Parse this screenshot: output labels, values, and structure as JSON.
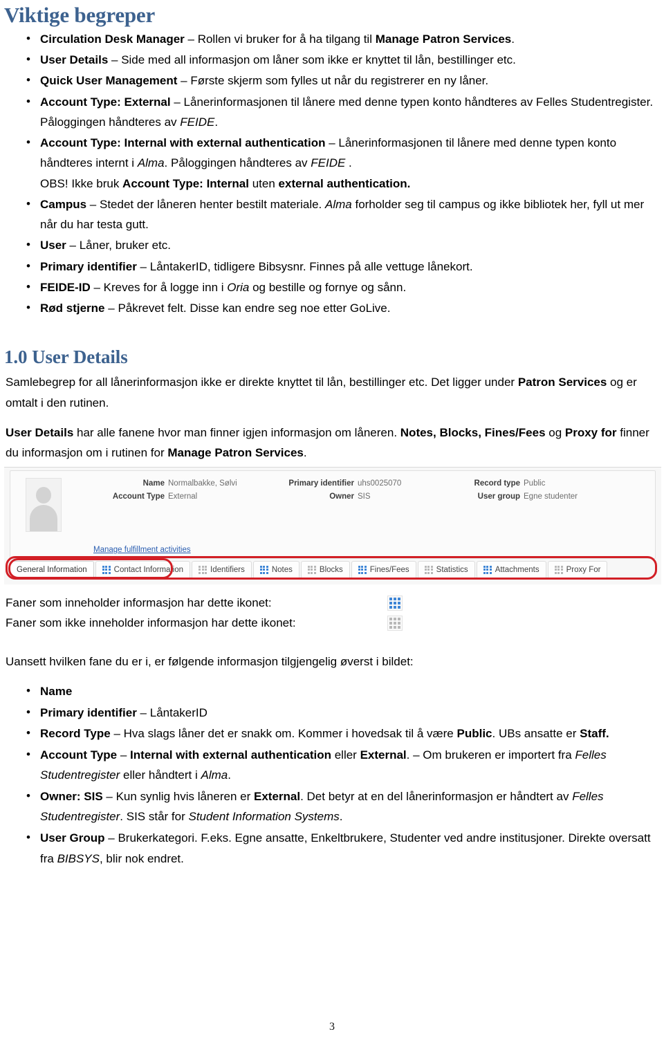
{
  "document": {
    "heading": "Viktige begreper",
    "page_number": "3"
  },
  "concepts": {
    "items": [
      {
        "term": "Circulation Desk Manager",
        "dash": " – ",
        "text_before": "Rollen vi bruker for å ha tilgang til ",
        "emphasis": "Manage Patron Services",
        "text_after": "."
      },
      {
        "term": "User Details",
        "dash": " – ",
        "text_before": "Side med all informasjon om låner som ikke er knyttet til lån, bestillinger etc.",
        "emphasis": "",
        "text_after": ""
      },
      {
        "term": "Quick User Management",
        "dash": " – ",
        "text_before": "Første skjerm som fylles ut når du registrerer en ny låner.",
        "emphasis": "",
        "text_after": ""
      }
    ],
    "account_type_external": {
      "term": "Account Type: External",
      "dash": " – ",
      "text": "Lånerinformasjonen til lånere med denne typen konto håndteres av Felles Studentregister. Påloggingen håndteres av ",
      "italic": "FEIDE",
      "text_end": "."
    },
    "account_type_internal": {
      "term": "Account Type: Internal with external authentication",
      "dash": " – ",
      "text1": "Lånerinformasjonen til lånere med denne typen konto håndteres internt i ",
      "italic1": "Alma",
      "text2": ". Påloggingen håndteres av ",
      "italic2": "FEIDE",
      "text3": " .",
      "obs_prefix": "OBS! Ikke bruk ",
      "obs_bold1": "Account Type: Internal",
      "obs_mid": " uten ",
      "obs_bold2": "external authentication."
    },
    "campus": {
      "term": "Campus",
      "dash": " – ",
      "text1": "Stedet der låneren henter bestilt materiale. ",
      "italic1": "Alma",
      "text2": " forholder seg til campus og ikke bibliotek her, fyll ut mer når du har testa gutt."
    },
    "user": {
      "term": "User",
      "dash": " – ",
      "text": "Låner, bruker etc."
    },
    "primary_identifier": {
      "term": "Primary identifier",
      "dash": " – ",
      "text": "LåntakerID, tidligere Bibsysnr. Finnes på alle vettuge lånekort."
    },
    "feide_id": {
      "term": "FEIDE-ID",
      "dash": " – ",
      "text1": "Kreves for å logge inn i ",
      "italic1": "Oria",
      "text2": " og bestille og fornye og sånn."
    },
    "rod_stjerne": {
      "term": "Rød stjerne",
      "dash": " – ",
      "text": "Påkrevet felt. Disse kan endre seg noe etter GoLive."
    }
  },
  "user_details_section": {
    "heading": "1.0 User Details",
    "paragraph1_text1": "Samlebegrep for all lånerinformasjon ikke er direkte knyttet til lån, bestillinger etc. Det ligger under ",
    "paragraph1_bold": "Patron Services",
    "paragraph1_text2": " og er omtalt i den rutinen.",
    "paragraph2_bold1": "User Details",
    "paragraph2_text1": " har alle fanene hvor man finner igjen informasjon om låneren. ",
    "paragraph2_bold2": "Notes, Blocks, Fines/Fees",
    "paragraph2_text2": " og ",
    "paragraph2_bold3": "Proxy for",
    "paragraph2_text3": " finner du informasjon om i rutinen for ",
    "paragraph2_bold4": "Manage Patron Services",
    "paragraph2_text4": "."
  },
  "alma_screenshot": {
    "fields": {
      "name_label": "Name",
      "name_value": "Normalbakke, Sølvi",
      "account_type_label": "Account Type",
      "account_type_value": "External",
      "primary_identifier_label": "Primary identifier",
      "primary_identifier_value": "uhs0025070",
      "owner_label": "Owner",
      "owner_value": "SIS",
      "record_type_label": "Record type",
      "record_type_value": "Public",
      "user_group_label": "User group",
      "user_group_value": "Egne studenter"
    },
    "manage_link": "Manage fulfillment activities",
    "tabs": [
      {
        "label": "General Information",
        "has_info": false,
        "active": true,
        "show_icon": false
      },
      {
        "label": "Contact Information",
        "has_info": true,
        "active": false,
        "show_icon": true
      },
      {
        "label": "Identifiers",
        "has_info": false,
        "active": false,
        "show_icon": true
      },
      {
        "label": "Notes",
        "has_info": true,
        "active": false,
        "show_icon": true
      },
      {
        "label": "Blocks",
        "has_info": false,
        "active": false,
        "show_icon": true
      },
      {
        "label": "Fines/Fees",
        "has_info": true,
        "active": false,
        "show_icon": true
      },
      {
        "label": "Statistics",
        "has_info": false,
        "active": false,
        "show_icon": true
      },
      {
        "label": "Attachments",
        "has_info": true,
        "active": false,
        "show_icon": true
      },
      {
        "label": "Proxy For",
        "has_info": false,
        "active": false,
        "show_icon": true
      }
    ],
    "annotation_color": "#d21f26"
  },
  "legend": {
    "has_info_text": "Faner som inneholder informasjon har dette ikonet:",
    "no_info_text": "Faner som ikke inneholder informasjon har dette ikonet:",
    "active_icon_color": "#3f86d6",
    "inactive_icon_color": "#b8b8b8"
  },
  "top_info": {
    "intro": "Uansett hvilken fane du er i, er følgende informasjon tilgjengelig øverst i bildet:",
    "items": {
      "name": {
        "term": "Name",
        "text": ""
      },
      "primary_identifier": {
        "term": "Primary identifier",
        "dash": " – ",
        "text": "LåntakerID"
      },
      "record_type": {
        "term": "Record Type",
        "dash": " – ",
        "text1": "Hva slags låner det er snakk om. Kommer i hovedsak til å være ",
        "bold1": "Public",
        "text2": ". UBs ansatte er ",
        "bold2": "Staff."
      },
      "account_type": {
        "term": "Account Type",
        "dash": " – ",
        "bold1": "Internal with external authentication",
        "text1": " eller ",
        "bold2": "External",
        "text2": ". – Om brukeren er importert fra ",
        "italic1": "Felles Studentregister",
        "text3": " eller håndtert i ",
        "italic2": "Alma",
        "text4": "."
      },
      "owner": {
        "term": "Owner: SIS",
        "dash": " – ",
        "text1": "Kun synlig hvis låneren er ",
        "bold1": "External",
        "text2": ". Det betyr at en del lånerinformasjon er håndtert av ",
        "italic1": "Felles Studentregister",
        "text3": ". SIS står for ",
        "italic2": "Student Information Systems",
        "text4": "."
      },
      "user_group": {
        "term": "User Group",
        "dash": " – ",
        "text1": "Brukerkategori. F.eks. Egne ansatte, Enkeltbrukere, Studenter ved andre institusjoner. Direkte oversatt fra ",
        "italic1": "BIBSYS",
        "text2": ", blir nok endret."
      }
    }
  }
}
